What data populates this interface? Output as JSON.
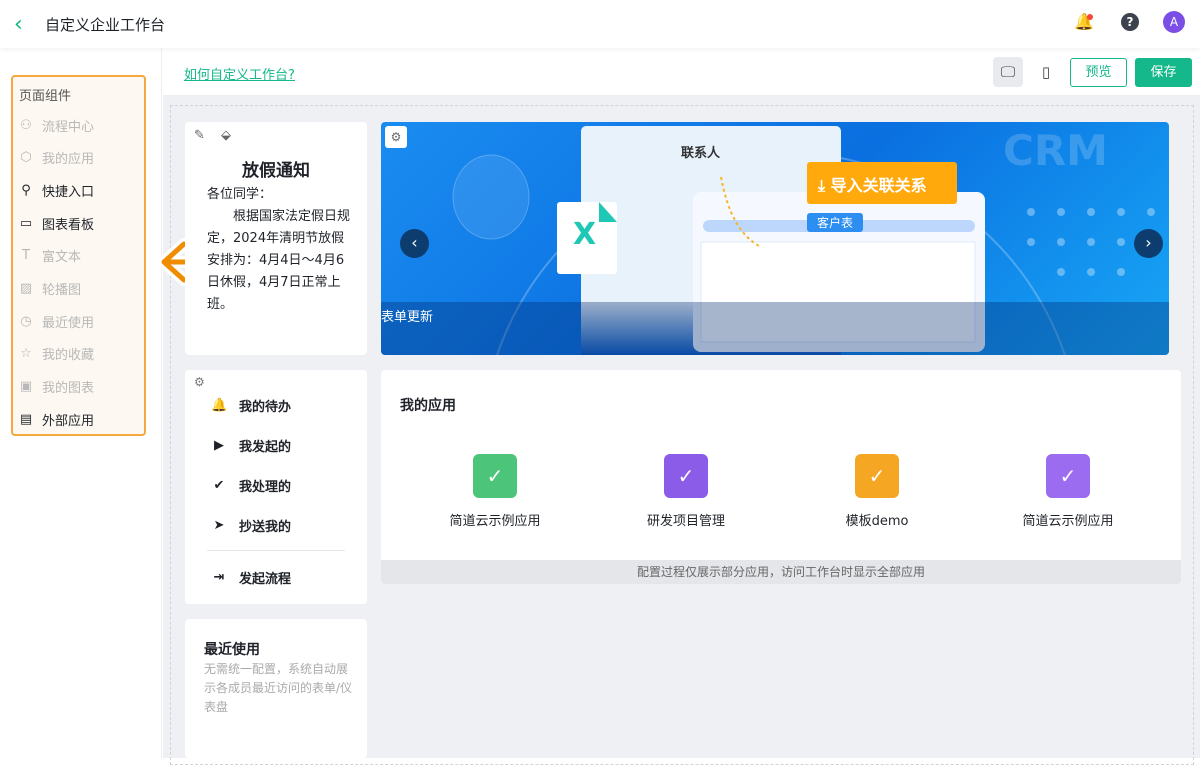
{
  "header": {
    "back": "‹",
    "title": "自定义企业工作台",
    "avatar": "A",
    "help": "?"
  },
  "sidebar": {
    "title": "页面组件",
    "items": [
      {
        "label": "流程中心",
        "icon": "⚇",
        "enabled": false
      },
      {
        "label": "我的应用",
        "icon": "⬡",
        "enabled": false
      },
      {
        "label": "快捷入口",
        "icon": "⚲",
        "enabled": true
      },
      {
        "label": "图表看板",
        "icon": "▭",
        "enabled": true
      },
      {
        "label": "富文本",
        "icon": "T",
        "enabled": false
      },
      {
        "label": "轮播图",
        "icon": "▨",
        "enabled": false
      },
      {
        "label": "最近使用",
        "icon": "◷",
        "enabled": false
      },
      {
        "label": "我的收藏",
        "icon": "☆",
        "enabled": false
      },
      {
        "label": "我的图表",
        "icon": "▣",
        "enabled": false
      },
      {
        "label": "外部应用",
        "icon": "▤",
        "enabled": true
      }
    ]
  },
  "toolbar": {
    "help_link": "如何自定义工作台?",
    "preview": "预览",
    "save": "保存"
  },
  "notice": {
    "title": "放假通知",
    "greeting": "各位同学：",
    "body": "　　根据国家法定假日规定，2024年清明节放假安排为：4月4日～4月6日休假，4月7日正常上班。"
  },
  "banner": {
    "contact": "联系人",
    "import": "导入关联关系",
    "customer": "客户表",
    "crm": "CRM",
    "caption": "表单更新",
    "excel": "X"
  },
  "quick": {
    "items": [
      {
        "label": "我的待办",
        "icon": "🔔"
      },
      {
        "label": "我发起的",
        "icon": "▶"
      },
      {
        "label": "我处理的",
        "icon": "✔"
      },
      {
        "label": "抄送我的",
        "icon": "➤"
      }
    ],
    "start": "发起流程"
  },
  "apps": {
    "title": "我的应用",
    "items": [
      {
        "label": "简道云示例应用",
        "color": "#4cc47a"
      },
      {
        "label": "研发项目管理",
        "color": "#8b5ce8"
      },
      {
        "label": "模板demo",
        "color": "#f5a623"
      },
      {
        "label": "简道云示例应用",
        "color": "#9b6cf0"
      }
    ],
    "note": "配置过程仅展示部分应用，访问工作台时显示全部应用"
  },
  "recent": {
    "title": "最近使用",
    "desc": "无需统一配置，系统自动展示各成员最近访问的表单/仪表盘"
  }
}
